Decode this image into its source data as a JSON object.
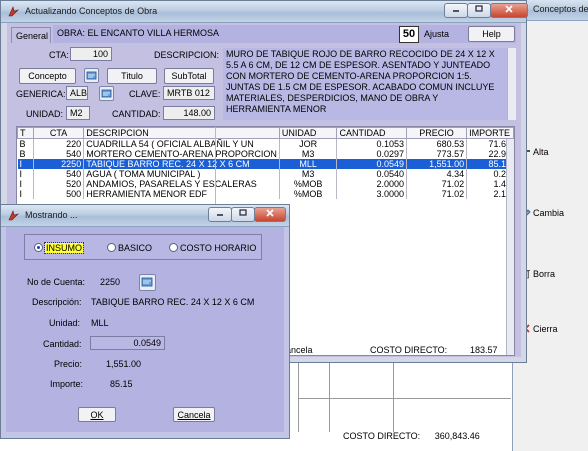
{
  "main_window": {
    "title": "Actualizando Conceptos de Obra",
    "tab": "General",
    "obra": "OBRA:  EL ENCANTO VILLA HERMOSA",
    "ajusta_label": "Ajusta",
    "help_label": "Help",
    "cta_label": "CTA:",
    "cta_value": "100",
    "descripcion_label": "DESCRIPCION:",
    "descripcion_text": "MURO DE TABIQUE ROJO DE BARRO RECOCIDO DE 24 X 12 X 5.5 A 6 CM, DE 12 CM DE ESPESOR. ASENTADO Y JUNTEADO CON MORTERO DE CEMENTO-ARENA PROPORCION 1:5. JUNTAS DE 1.5 CM DE ESPESOR. ACABADO COMUN INCLUYE MATERIALES, DESPERDICIOS, MANO DE OBRA Y HERRAMIENTA MENOR",
    "concepto_btn": "Concepto",
    "titulo_btn": "Titulo",
    "subtotal_btn": "SubTotal",
    "generica_label": "GENERICA:",
    "generica_value": "ALB",
    "clave_label": "CLAVE:",
    "clave_value": "MRTB 012",
    "unidad_label": "UNIDAD:",
    "unidad_value": "M2",
    "cantidad_label": "CANTIDAD:",
    "cantidad_value": "148.00",
    "status_left": "ancela",
    "costo_directo_label": "COSTO DIRECTO:",
    "costo_directo_value": "183.57"
  },
  "grid": {
    "columns": [
      "T",
      "CTA",
      "DESCRIPCION",
      "UNIDAD",
      "CANTIDAD",
      "PRECIO",
      "IMPORTE"
    ],
    "rows": [
      [
        "B",
        "220",
        "CUADRILLA 54 ( OFICIAL ALBAÑIL Y UN",
        "JOR",
        "0.1053",
        "680.53",
        "71.66"
      ],
      [
        "B",
        "540",
        "MORTERO CEMENTO-ARENA PROPORCION",
        "M3",
        "0.0297",
        "773.57",
        "22.98"
      ],
      [
        "I",
        "2250",
        "TABIQUE BARRO REC. 24 X 12 X 6 CM",
        "MLL",
        "0.0549",
        "1,551.00",
        "85.15"
      ],
      [
        "I",
        "540",
        "AGUA ( TOMA MUNICIPAL )",
        "M3",
        "0.0540",
        "4.34",
        "0.23"
      ],
      [
        "I",
        "520",
        "ANDAMIOS, PASARELAS Y ESCALERAS",
        "%MOB",
        "2.0000",
        "71.02",
        "1.42"
      ],
      [
        "I",
        "500",
        "HERRAMIENTA MENOR EDF",
        "%MOB",
        "3.0000",
        "71.02",
        "2.13"
      ]
    ],
    "selected_index": 2
  },
  "background_window": {
    "title": "Conceptos de O",
    "side_buttons": [
      "Alta",
      "Cambia",
      "Borra",
      "Cierra"
    ],
    "costo_directo_label": "COSTO DIRECTO:",
    "costo_directo_value": "360,843.46"
  },
  "dialog": {
    "title": "Mostrando ...",
    "radio_options": [
      "INSUMO",
      "BASICO",
      "COSTO HORARIO"
    ],
    "selected_radio": "INSUMO",
    "no_cuenta_label": "No de Cuenta:",
    "no_cuenta_value": "2250",
    "descripcion_label": "Descripción:",
    "descripcion_value": "TABIQUE BARRO REC. 24 X 12 X 6 CM",
    "unidad_label": "Unidad:",
    "unidad_value": "MLL",
    "cantidad_label": "Cantidad:",
    "cantidad_value": "0.0549",
    "precio_label": "Precio:",
    "precio_value": "1,551.00",
    "importe_label": "Importe:",
    "importe_value": "85.15",
    "ok_label": "OK",
    "cancel_label": "Cancela"
  }
}
